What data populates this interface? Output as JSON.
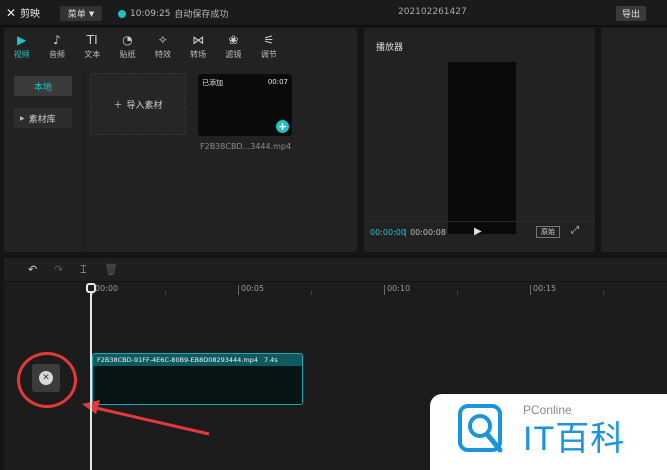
{
  "app": {
    "logo_text": "剪映",
    "menu_label": "菜单",
    "autosave_time": "10:09:25",
    "autosave_text": "自动保存成功",
    "project_name": "202102261427",
    "export_label": "导出"
  },
  "media": {
    "tabs": [
      {
        "label": "视频",
        "icon": "video-icon"
      },
      {
        "label": "音频",
        "icon": "audio-icon"
      },
      {
        "label": "文本",
        "icon": "text-icon"
      },
      {
        "label": "贴纸",
        "icon": "sticker-icon"
      },
      {
        "label": "特效",
        "icon": "effects-icon"
      },
      {
        "label": "转场",
        "icon": "transition-icon"
      },
      {
        "label": "滤镜",
        "icon": "filter-icon"
      },
      {
        "label": "调节",
        "icon": "adjust-icon"
      }
    ],
    "tab_glyphs": [
      "▶",
      "♪",
      "TI",
      "◔",
      "✧",
      "⋈",
      "❀",
      "⚟"
    ],
    "sidebar": [
      {
        "label": "本地"
      },
      {
        "label": "素材库"
      }
    ],
    "import_label": "导入素材",
    "clip": {
      "added_badge": "已添加",
      "duration": "00:07",
      "name": "F2B38CBD...3444.mp4"
    }
  },
  "player": {
    "title": "播放器",
    "current_time": "00:00:00",
    "total_time": "00:00:08",
    "original_label": "原始"
  },
  "timeline": {
    "ticks": [
      "00:00",
      "00:05",
      "00:10",
      "00:15"
    ],
    "clip_title": "F2B38CBD-91FF-4E6C-80B9-EB8D08293444.mp4",
    "clip_duration": "7.4s"
  },
  "watermark": {
    "top": "PConline",
    "main": "IT百科"
  },
  "colors": {
    "accent": "#21c0c8",
    "highlight": "#e23a3a",
    "watermark_blue": "#1a95dd"
  }
}
